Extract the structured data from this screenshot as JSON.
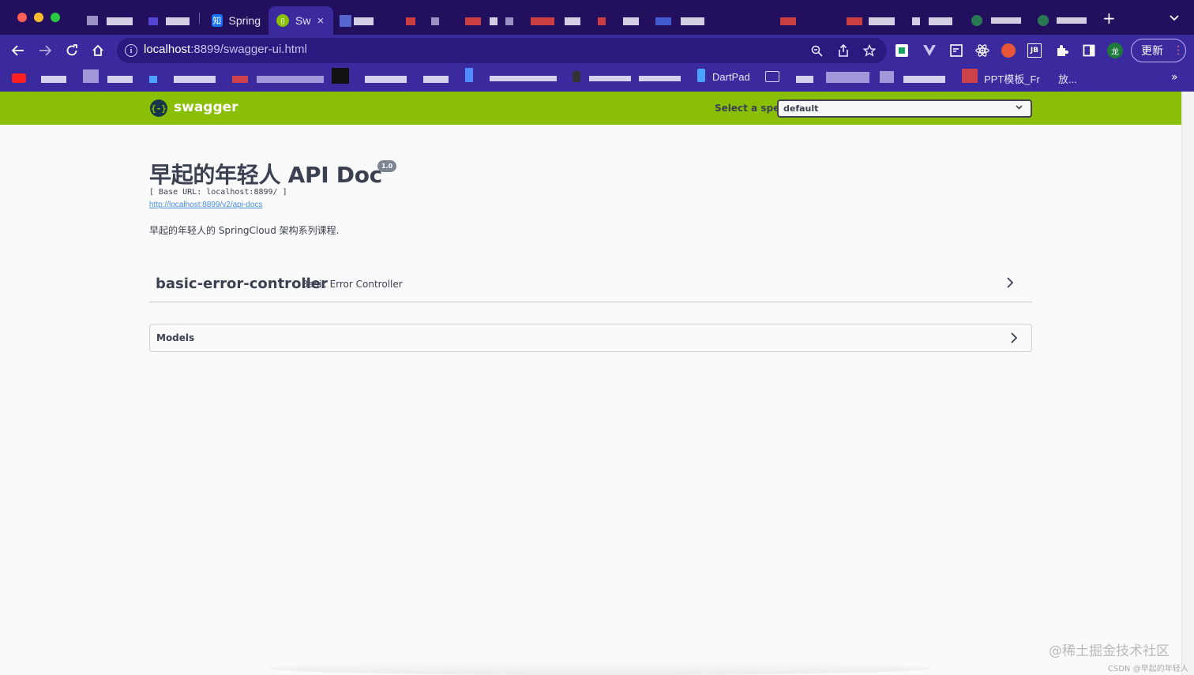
{
  "browser": {
    "tabs": [
      {
        "label": "Spring",
        "icon": "zhihu-icon",
        "icon_glyph": "知"
      },
      {
        "label": "Sw",
        "icon": "swagger-icon",
        "icon_glyph": "{}",
        "active": true
      }
    ],
    "tab_close_glyph": "×",
    "new_tab_glyph": "+",
    "address": {
      "host": "localhost",
      "path": ":8899/swagger-ui.html"
    },
    "update_label": "更新",
    "update_menu_glyph": "⋮",
    "profile_initial": "龙",
    "bookmarks": [
      {
        "label": "DartPad"
      },
      {
        "label": "PPT模板_Fr"
      },
      {
        "label": "放..."
      }
    ],
    "bookmarks_more_glyph": "»"
  },
  "swagger": {
    "logo_text": "swagger",
    "logo_mark": "{-}",
    "spec_label": "Select a spec",
    "spec_value": "default",
    "title": "早起的年轻人 API Doc",
    "version": "1.0",
    "base_url": "[ Base URL: localhost:8899/ ]",
    "spec_link": "http://localhost:8899/v2/api-docs",
    "description": "早起的年轻人的 SpringCloud 架构系列课程.",
    "tags": [
      {
        "name": "basic-error-controller",
        "description": "Basic Error Controller"
      }
    ],
    "models_title": "Models"
  },
  "watermark": {
    "main": "@稀土掘金技术社区",
    "sub": "CSDN @早起的年轻人"
  },
  "colors": {
    "tabbar": "#22105e",
    "toolbar": "#3a2a9e",
    "swagger_green": "#89bf04",
    "text": "#3b4151",
    "link": "#4990e2"
  }
}
